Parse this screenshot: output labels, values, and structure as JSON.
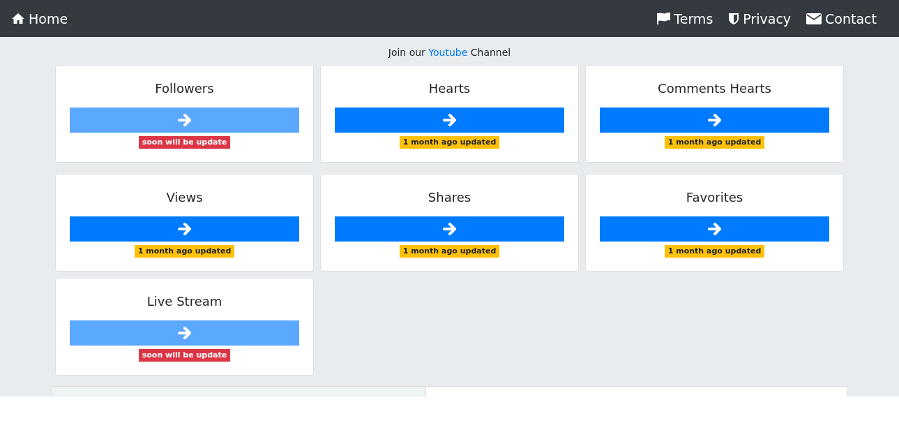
{
  "navbar": {
    "home": "Home",
    "links": [
      {
        "kind": "flag",
        "label": "Terms"
      },
      {
        "kind": "shield",
        "label": "Privacy"
      },
      {
        "kind": "mail",
        "label": "Contact"
      }
    ]
  },
  "promo": {
    "before": "Join our",
    "link": "Youtube",
    "after": "Channel"
  },
  "cards": [
    {
      "title": "Followers",
      "disabled": true,
      "badge": {
        "kind": "soon",
        "text": "soon will be update"
      }
    },
    {
      "title": "Hearts",
      "disabled": false,
      "badge": {
        "kind": "updated",
        "text": "1 month ago updated"
      }
    },
    {
      "title": "Comments Hearts",
      "disabled": false,
      "badge": {
        "kind": "updated",
        "text": "1 month ago updated"
      }
    },
    {
      "title": "Views",
      "disabled": false,
      "badge": {
        "kind": "updated",
        "text": "1 month ago updated"
      }
    },
    {
      "title": "Shares",
      "disabled": false,
      "badge": {
        "kind": "updated",
        "text": "1 month ago updated"
      }
    },
    {
      "title": "Favorites",
      "disabled": false,
      "badge": {
        "kind": "updated",
        "text": "1 month ago updated"
      }
    },
    {
      "title": "Live Stream",
      "disabled": true,
      "badge": {
        "kind": "soon",
        "text": "soon will be update"
      }
    }
  ]
}
